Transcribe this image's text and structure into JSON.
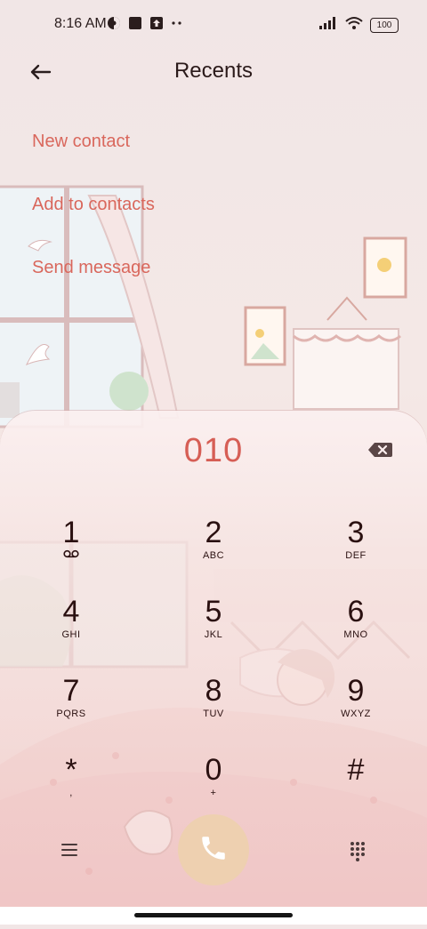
{
  "status_bar": {
    "time": "8:16 AM",
    "battery": "100",
    "icons": [
      "vpn-icon",
      "notification-square-icon",
      "upload-icon",
      "more-dots-icon",
      "signal-icon",
      "wifi-icon",
      "battery-icon"
    ]
  },
  "header": {
    "title": "Recents",
    "back_icon": "arrow-left-icon"
  },
  "actions": {
    "new_contact": "New contact",
    "add_to_contacts": "Add to contacts",
    "send_message": "Send message"
  },
  "dialer": {
    "number": "010",
    "backspace_icon": "backspace-icon",
    "keys": [
      {
        "digit": "1",
        "letters": ""
      },
      {
        "digit": "2",
        "letters": "ABC"
      },
      {
        "digit": "3",
        "letters": "DEF"
      },
      {
        "digit": "4",
        "letters": "GHI"
      },
      {
        "digit": "5",
        "letters": "JKL"
      },
      {
        "digit": "6",
        "letters": "MNO"
      },
      {
        "digit": "7",
        "letters": "PQRS"
      },
      {
        "digit": "8",
        "letters": "TUV"
      },
      {
        "digit": "9",
        "letters": "WXYZ"
      },
      {
        "digit": "*",
        "letters": ","
      },
      {
        "digit": "0",
        "letters": "+"
      },
      {
        "digit": "#",
        "letters": ""
      }
    ],
    "bottom": {
      "menu_icon": "menu-icon",
      "call_icon": "phone-icon",
      "keypad_icon": "keypad-icon"
    }
  },
  "colors": {
    "accent": "#d9675c",
    "number": "#d65e55",
    "call_button": "#eed0b0",
    "text_dark": "#2a1010"
  }
}
